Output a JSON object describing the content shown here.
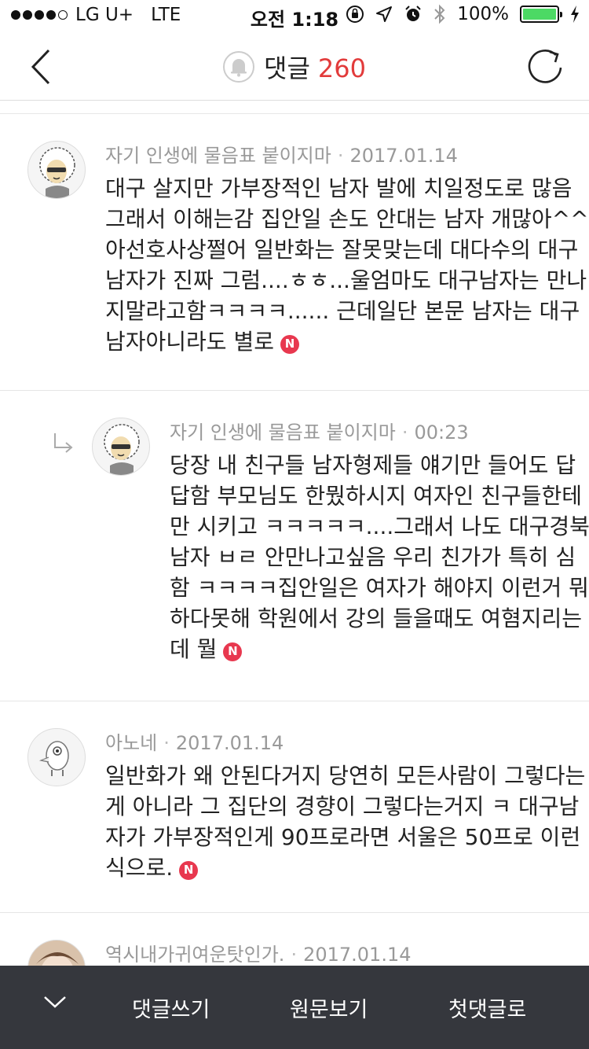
{
  "status_bar": {
    "carrier": "LG U+",
    "network": "LTE",
    "time": "오전 1:18",
    "battery": "100%",
    "battery_level": 1.0
  },
  "header": {
    "title": "댓글",
    "count": "260"
  },
  "comments": [
    {
      "author": "자기 인생에 물음표 붙이지마",
      "date": "2017.01.14",
      "lines": [
        "대구 살지만 가부장적인 남자 발에 치일정도로 많음",
        "그래서 이해는감 집안일 손도 안대는 남자 개많아^^남",
        "아선호사상쩔어 일반화는 잘못맞는데 대다수의 대구",
        "남자가 진짜 그럼....ㅎㅎ...울엄마도 대구남자는 만나",
        "지말라고함ㅋㅋㅋㅋ...... 근데일단 본문 남자는 대구",
        "남자아니라도 별로"
      ],
      "badge": "N",
      "avatar_icon": "afro-character-avatar"
    },
    {
      "author": "자기 인생에 물음표 붙이지마",
      "date": "00:23",
      "lines": [
        "당장 내 친구들 남자형제들 얘기만 들어도 답",
        "답함 부모님도 한뭤하시지 여자인 친구들한테",
        "만 시키고 ㅋㅋㅋㅋㅋ....그래서 나도 대구경북",
        "남자 ㅂㄹ 안만나고싶음 우리 친가가 특히 심",
        "함 ㅋㅋㅋㅋ집안일은 여자가 해야지 이런거 뭐",
        "하다못해 학원에서 강의 들을때도 여혐지리는",
        "데 뭘"
      ],
      "badge": "N",
      "avatar_icon": "afro-character-avatar"
    },
    {
      "author": "아노네",
      "date": "2017.01.14",
      "lines": [
        "일반화가 왜 안된다거지 당연히 모든사람이 그렇다는",
        "게 아니라 그 집단의 경향이 그렇다는거지 ㅋ 대구남",
        "자가 가부장적인게 90프로라면 서울은 50프로 이런",
        "식으로."
      ],
      "badge": "N",
      "avatar_icon": "creature-character-avatar"
    },
    {
      "author": "역시내가귀여운탓인가.",
      "date": "2017.01.14",
      "lines": [],
      "avatar_icon": "child-photo-avatar"
    }
  ],
  "bottom_bar": {
    "write_label": "댓글쓰기",
    "original_label": "원문보기",
    "first_label": "첫댓글로"
  },
  "colors": {
    "accent": "#e23b3b",
    "badge": "#e8384f",
    "bottom_bar": "#35373d"
  }
}
